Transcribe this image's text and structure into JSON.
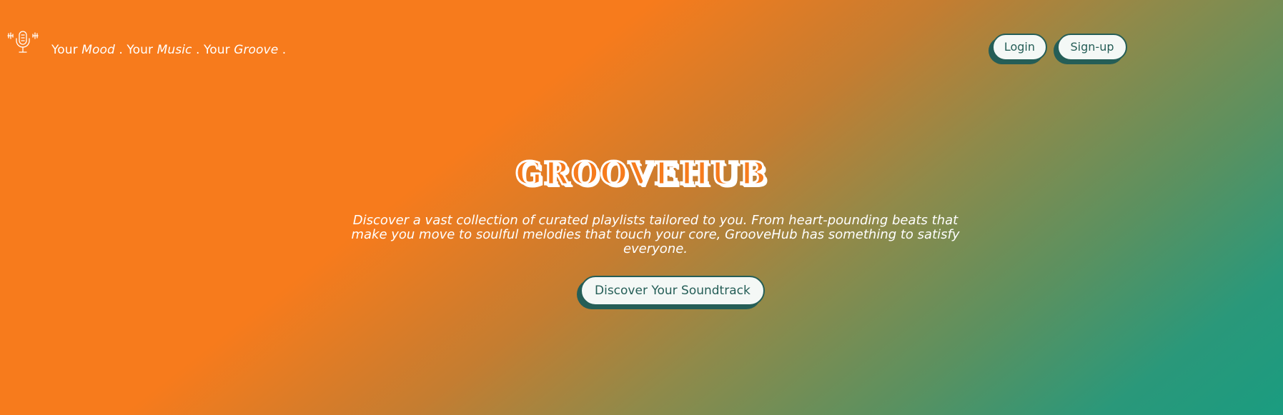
{
  "brand": {
    "icon": "microphone-icon",
    "tagline_parts": [
      "Your ",
      "Mood",
      ". Your ",
      "Music",
      ". Your ",
      "Groove",
      "."
    ]
  },
  "nav": {
    "login_label": "Login",
    "signup_label": "Sign-up"
  },
  "hero": {
    "title": "GROOVEHUB",
    "description": "Discover a vast collection of curated playlists tailored to you. From heart-pounding beats that make you move to soulful melodies that touch your core, GrooveHub has something to satisfy everyone.",
    "cta_label": "Discover Your Soundtrack"
  },
  "colors": {
    "orange": "#f77b1c",
    "teal": "#1a9c80",
    "button_dark": "#255e57",
    "button_bg": "#f4f8f6",
    "text_light": "#ffffff"
  }
}
